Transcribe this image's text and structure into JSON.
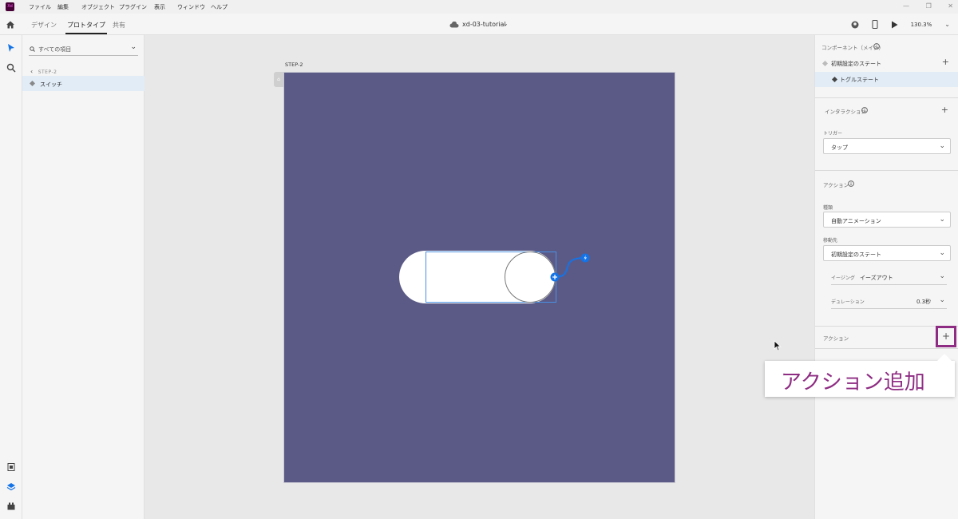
{
  "app": {
    "logo_text": "Xd"
  },
  "menu": [
    "ファイル",
    "編集",
    "オブジェクト",
    "プラグイン",
    "表示",
    "ウィンドウ",
    "ヘルプ"
  ],
  "tabs": [
    "デザイン",
    "プロトタイプ",
    "共有"
  ],
  "active_tab": "プロトタイプ",
  "document": {
    "title": "xd-03-tutorial"
  },
  "zoom": "130.3%",
  "layers": {
    "search_placeholder": "すべての項目",
    "breadcrumb": "STEP-2",
    "items": [
      {
        "label": "スイッチ",
        "selected": true
      }
    ]
  },
  "canvas": {
    "artboard_label": "STEP-2",
    "artboard_color": "#5b5a87"
  },
  "right_panel": {
    "component_heading": "コンポーネント（メイン）",
    "states": [
      {
        "label": "初期設定のステート",
        "selected": false
      },
      {
        "label": "トグルステート",
        "selected": true
      }
    ],
    "interaction_heading": "インタラクション",
    "trigger_label": "トリガー",
    "trigger_value": "タップ",
    "action_heading": "アクション",
    "type_label": "種類",
    "type_value": "自動アニメーション",
    "destination_label": "移動先",
    "destination_value": "初期設定のステート",
    "easing_label": "イージング",
    "easing_value": "イーズアウト",
    "duration_label": "デュレーション",
    "duration_value": "0.3秒",
    "action2_heading": "アクション",
    "add_symbol": "+"
  },
  "callout": {
    "text": "アクション追加",
    "color": "#8e2c83"
  }
}
